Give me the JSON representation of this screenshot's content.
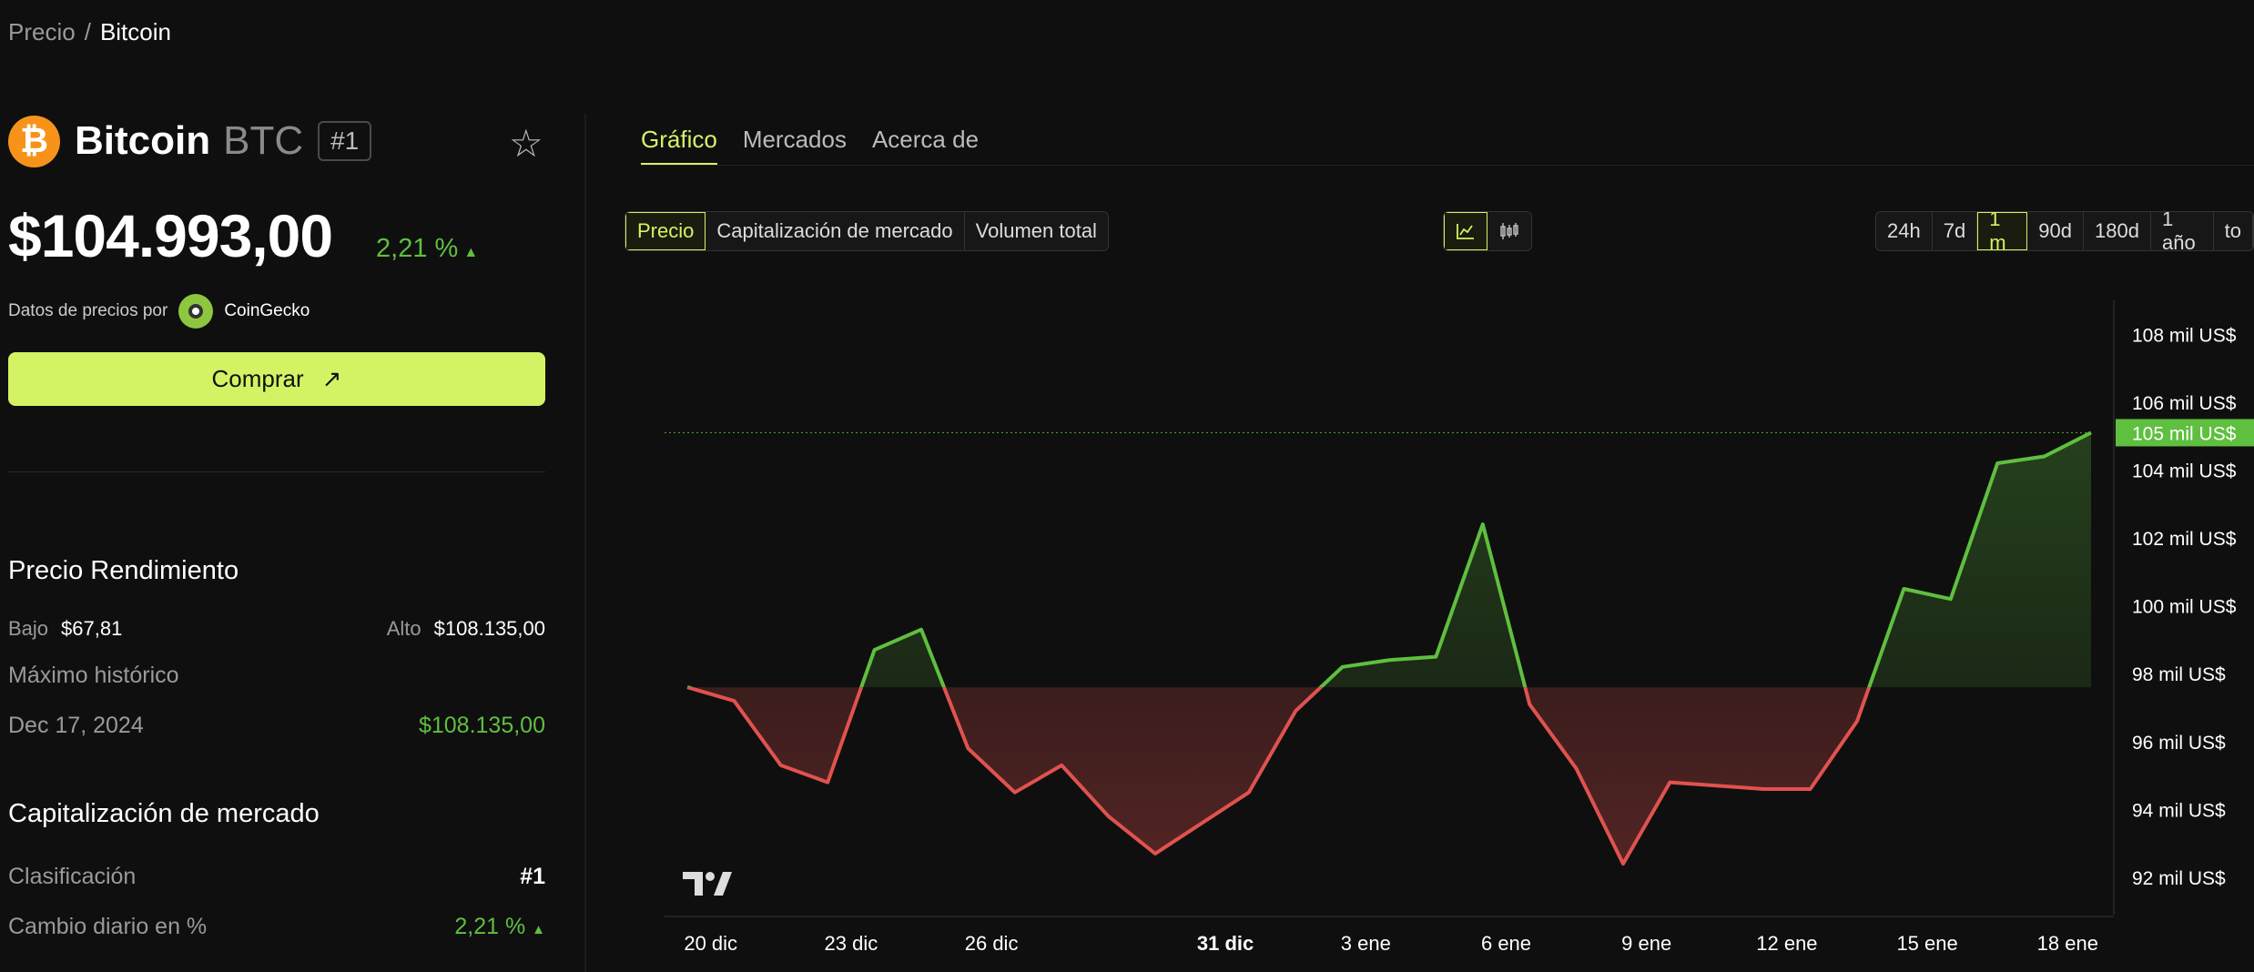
{
  "breadcrumb": {
    "parent": "Precio",
    "separator": "/",
    "current": "Bitcoin"
  },
  "coin": {
    "logo_glyph": "₿",
    "name": "Bitcoin",
    "ticker": "BTC",
    "rank_badge": "#1",
    "price": "$104.993,00",
    "change": "2,21 %",
    "change_arrow": "▲"
  },
  "source": {
    "label": "Datos de precios por",
    "name": "CoinGecko"
  },
  "buy_button": {
    "label": "Comprar",
    "arrow": "↗"
  },
  "performance": {
    "title": "Precio Rendimiento",
    "low_label": "Bajo",
    "low_value": "$67,81",
    "high_label": "Alto",
    "high_value": "$108.135,00",
    "ath_label": "Máximo histórico",
    "ath_date": "Dec 17, 2024",
    "ath_value": "$108.135,00"
  },
  "market_cap": {
    "title": "Capitalización de mercado",
    "rank_label": "Clasificación",
    "rank_value": "#1",
    "daily_change_label": "Cambio diario en %",
    "daily_change_value": "2,21 %",
    "daily_change_arrow": "▲"
  },
  "tabs": [
    "Gráfico",
    "Mercados",
    "Acerca de"
  ],
  "metric_selector": [
    "Precio",
    "Capitalización de mercado",
    "Volumen total"
  ],
  "chart_type_icons": [
    "line-chart-icon",
    "candlestick-icon"
  ],
  "time_ranges": [
    "24h",
    "7d",
    "1 m",
    "90d",
    "180d",
    "1 año",
    "to"
  ],
  "colors": {
    "accent": "#d4f364",
    "up": "#5fbf3f",
    "down": "#e0524f",
    "background": "#0f0f0f"
  },
  "chart_data": {
    "type": "line",
    "title": "",
    "xlabel": "",
    "ylabel": "",
    "x_tick_labels": [
      "20 dic",
      "23 dic",
      "26 dic",
      "31 dic",
      "3 ene",
      "6 ene",
      "9 ene",
      "12 ene",
      "15 ene",
      "18 ene"
    ],
    "y_tick_labels": [
      "108 mil US$",
      "106 mil US$",
      "104 mil US$",
      "102 mil US$",
      "100 mil US$",
      "98 mil US$",
      "96 mil US$",
      "94 mil US$",
      "92 mil US$"
    ],
    "current_price_label": "105 mil US$",
    "baseline": 97.6,
    "ylim": [
      90.9,
      109
    ],
    "y_unit": "mil US$",
    "series": [
      {
        "values": [
          97.6,
          97.2,
          95.3,
          94.8,
          98.7,
          99.3,
          95.8,
          94.5,
          95.3,
          93.8,
          92.7,
          93.6,
          94.5,
          96.9,
          98.2,
          98.4,
          98.5,
          102.4,
          97.1,
          95.2,
          92.4,
          94.8,
          94.7,
          94.6,
          94.6,
          96.6,
          100.5,
          100.2,
          104.2,
          104.4,
          105.1
        ]
      }
    ]
  }
}
